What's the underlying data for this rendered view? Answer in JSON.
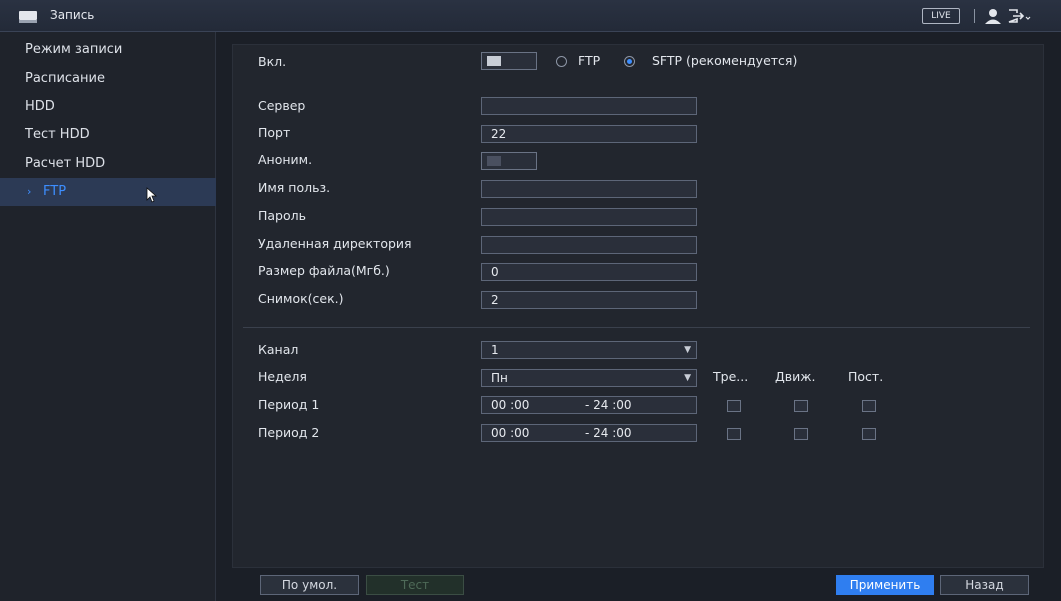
{
  "titlebar": {
    "title": "Запись",
    "live_label": "LIVE",
    "icons": [
      "hdd-icon",
      "user-icon",
      "logout-icon"
    ]
  },
  "sidebar": {
    "items": [
      {
        "label": "Режим записи",
        "active": false
      },
      {
        "label": "Расписание",
        "active": false
      },
      {
        "label": "HDD",
        "active": false
      },
      {
        "label": "Тест HDD",
        "active": false
      },
      {
        "label": "Расчет HDD",
        "active": false
      },
      {
        "label": "FTP",
        "active": true
      }
    ]
  },
  "form": {
    "enable_label": "Вкл.",
    "enable_on": false,
    "protocol_options": [
      "FTP",
      "SFTP (рекомендуется)"
    ],
    "protocol_selected": "SFTP (рекомендуется)",
    "server_label": "Сервер",
    "server_value": "",
    "port_label": "Порт",
    "port_value": "22",
    "anon_label": "Аноним.",
    "anon_on": false,
    "user_label": "Имя польз.",
    "user_value": "",
    "password_label": "Пароль",
    "password_value": "",
    "remote_dir_label": "Удаленная директория",
    "remote_dir_value": "",
    "file_size_label": "Размер файла(Мгб.)",
    "file_size_value": "0",
    "snapshot_label": "Снимок(сек.)",
    "snapshot_value": "2",
    "channel_label": "Канал",
    "channel_value": "1",
    "week_label": "Неделя",
    "week_value": "Пн",
    "col_alarm": "Тре...",
    "col_motion": "Движ.",
    "col_regular": "Пост.",
    "periods": [
      {
        "label": "Период 1",
        "start": "00 :00",
        "end": "- 24 :00",
        "alarm": false,
        "motion": false,
        "regular": false
      },
      {
        "label": "Период 2",
        "start": "00 :00",
        "end": "- 24 :00",
        "alarm": false,
        "motion": false,
        "regular": false
      }
    ]
  },
  "buttons": {
    "default": "По умол.",
    "test": "Тест",
    "apply": "Применить",
    "back": "Назад"
  },
  "colors": {
    "accent": "#3d8eff",
    "apply_bg": "#2f7ef0",
    "background": "#1b1f27"
  }
}
